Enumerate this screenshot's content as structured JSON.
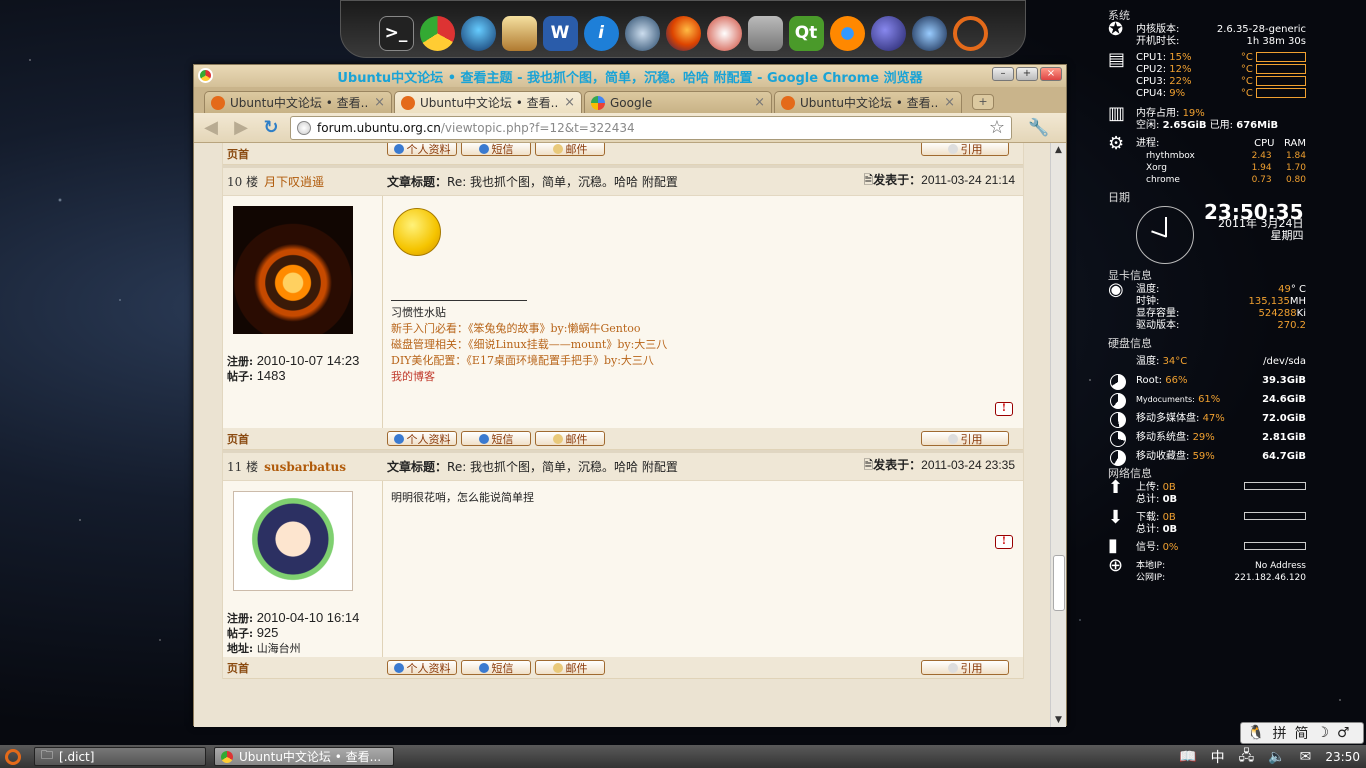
{
  "dock": {
    "items": [
      "terminal",
      "chrome",
      "qq",
      "dict",
      "word",
      "irc",
      "thunderbird",
      "firefox",
      "redpanda",
      "calc",
      "qt",
      "blender",
      "eclipse",
      "aquarium",
      "ubuntu"
    ],
    "labels": [
      ">_",
      "",
      "",
      "",
      "W",
      "i",
      "",
      "",
      "",
      "",
      "Qt",
      "",
      "",
      "",
      ""
    ]
  },
  "window": {
    "title": "Ubuntu中文论坛 • 查看主题 - 我也抓个图，简单，沉稳。哈哈 附配置 - Google Chrome 浏览器",
    "controls": [
      "–",
      "+",
      "×"
    ]
  },
  "tabs": [
    {
      "label": "Ubuntu中文论坛 • 查看...",
      "close": "×",
      "favicon": "ubuntu"
    },
    {
      "label": "Ubuntu中文论坛 • 查看...",
      "close": "×",
      "favicon": "ubuntu"
    },
    {
      "label": "Google",
      "close": "×",
      "favicon": "google"
    },
    {
      "label": "Ubuntu中文论坛 • 查看...",
      "close": "×",
      "favicon": "ubuntu"
    }
  ],
  "newtab": "+",
  "toolbar": {
    "back": "◀",
    "forward": "▶",
    "reload": "↻",
    "host": "forum.ubuntu.org.cn",
    "path": "/viewtopic.php?f=12&t=322434",
    "star": "☆",
    "wrench": "🔧"
  },
  "forum": {
    "top_label": "页首",
    "buttons": {
      "profile": "个人资料",
      "pm": "短信",
      "email": "邮件",
      "quote": "引用"
    },
    "report": "!",
    "posts": [
      {
        "floor": "10 楼",
        "poster": "月下叹逍遥",
        "subject_label": "文章标题：",
        "subject": "Re: 我也抓个图，简单，沉稳。哈哈 附配置",
        "date_label": "发表于：",
        "date": "2011-03-24 21:14",
        "reg_label": "注册:",
        "reg": "2010-10-07 14:23",
        "posts_label": "帖子:",
        "posts": "1483",
        "sig": {
          "l0": "习惯性水贴",
          "l1": "新手入门必看：《笨兔兔的故事》by:懒蜗牛Gentoo",
          "l2": "磁盘管理相关：《细说Linux挂载——mount》by:大三八",
          "l3": "DIY美化配置：《E17桌面环境配置手把手》by:大三八",
          "l4": "我的博客"
        }
      },
      {
        "floor": "11 楼",
        "poster": "susbarbatus",
        "subject_label": "文章标题：",
        "subject": "Re: 我也抓个图，简单，沉稳。哈哈 附配置",
        "date_label": "发表于：",
        "date": "2011-03-24 23:35",
        "reg_label": "注册:",
        "reg": "2010-04-10 16:14",
        "posts_label": "帖子:",
        "posts": "925",
        "loc_label": "地址:",
        "loc": "山海台州",
        "body": "明明很花哨，怎么能说简单捏"
      }
    ]
  },
  "conky": {
    "system": "系统",
    "kernel_label": "内核版本:",
    "kernel": "2.6.35-28-generic",
    "uptime_label": "开机时长:",
    "uptime": "1h 38m 30s",
    "cpus": [
      {
        "label": "CPU1:",
        "val": "15%",
        "unit": "°C"
      },
      {
        "label": "CPU2:",
        "val": "12%",
        "unit": "°C"
      },
      {
        "label": "CPU3:",
        "val": "22%",
        "unit": "°C"
      },
      {
        "label": "CPU4:",
        "val": "9%",
        "unit": "°C"
      }
    ],
    "mem_label": "内存占用:",
    "mem": "19%",
    "free_label": "空闲:",
    "free": "2.65GiB",
    "used_label": "已用:",
    "used": "676MiB",
    "proc_label": "进程:",
    "cpu_h": "CPU",
    "ram_h": "RAM",
    "procs": [
      {
        "name": "rhythmbox",
        "cpu": "2.43",
        "ram": "1.84"
      },
      {
        "name": "Xorg",
        "cpu": "1.94",
        "ram": "1.70"
      },
      {
        "name": "chrome",
        "cpu": "0.73",
        "ram": "0.80"
      }
    ],
    "date_title": "日期",
    "time": "23:50:35",
    "date": "2011年 3月24日",
    "weekday": "星期四",
    "gpu_title": "显卡信息",
    "gpu_temp_label": "温度:",
    "gpu_temp": "49",
    "gpu_temp_unit": "° C",
    "gpu_clock_label": "时钟:",
    "gpu_clock": "135,135",
    "gpu_clock_unit": "MH",
    "gpu_mem_label": "显存容量:",
    "gpu_mem": "524288",
    "gpu_mem_unit": "Ki",
    "driver_label": "驱动版本:",
    "driver": "270.2",
    "disk_title": "硬盘信息",
    "disk_temp_label": "温度:",
    "disk_temp": "34°C",
    "disk_dev": "/dev/sda",
    "disks": [
      {
        "name": "Root:",
        "pct": "66%",
        "size": "39.3GiB"
      },
      {
        "name": "Mydocuments:",
        "pct": "61%",
        "size": "24.6GiB"
      },
      {
        "name": "移动多媒体盘:",
        "pct": "47%",
        "size": "72.0GiB"
      },
      {
        "name": "移动系统盘:",
        "pct": "29%",
        "size": "2.81GiB"
      },
      {
        "name": "移动收藏盘:",
        "pct": "59%",
        "size": "64.7GiB"
      }
    ],
    "net_title": "网络信息",
    "up_label": "上传:",
    "up": "0B",
    "up_total_label": "总计:",
    "up_total": "0B",
    "down_label": "下载:",
    "down": "0B",
    "down_total_label": "总计:",
    "down_total": "0B",
    "signal_label": "信号:",
    "signal": "0%",
    "lip_label": "本地IP:",
    "lip": "No Address",
    "wip_label": "公网IP:",
    "wip": "221.182.46.120"
  },
  "ime": {
    "items": [
      "拼",
      "简",
      "☽",
      "♂"
    ]
  },
  "taskbar": {
    "task1": "[.dict]",
    "task2": "Ubuntu中文论坛 • 查看...",
    "clock": "23:50",
    "tray_zh": "中"
  }
}
